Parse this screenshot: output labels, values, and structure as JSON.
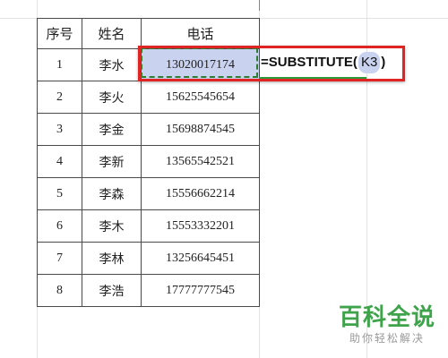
{
  "table": {
    "headers": [
      "序号",
      "姓名",
      "电话"
    ],
    "rows": [
      {
        "seq": "1",
        "name": "李水",
        "phone": "13020017174"
      },
      {
        "seq": "2",
        "name": "李火",
        "phone": "15625545654"
      },
      {
        "seq": "3",
        "name": "李金",
        "phone": "15698874545"
      },
      {
        "seq": "4",
        "name": "李新",
        "phone": "13565542521"
      },
      {
        "seq": "5",
        "name": "李森",
        "phone": "15556662214"
      },
      {
        "seq": "6",
        "name": "李木",
        "phone": "15553332201"
      },
      {
        "seq": "7",
        "name": "李林",
        "phone": "13256645451"
      },
      {
        "seq": "8",
        "name": "李浩",
        "phone": "17777777545"
      }
    ]
  },
  "formula": {
    "prefix": "=SUBSTITUTE(",
    "reference": "K3",
    "suffix": ")"
  },
  "watermark": {
    "title": "百科全说",
    "subtitle": "助你轻松解决"
  },
  "colors": {
    "selection": "#c9d3ef",
    "highlight_border": "#e02424",
    "marching_ants": "#2e7d32",
    "watermark": "#3ea34a"
  }
}
